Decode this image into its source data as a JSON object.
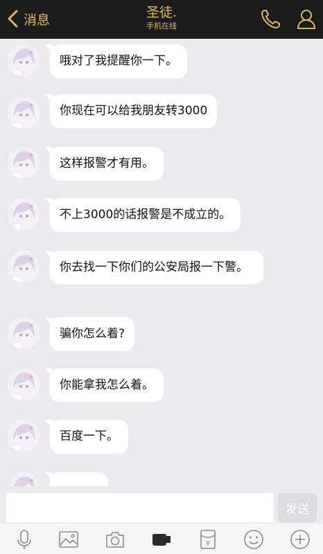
{
  "header": {
    "back_label": "消息",
    "contact_name": "圣徒.",
    "status": "手机在线"
  },
  "messages": [
    {
      "text": "哦对了我提醒你一下。"
    },
    {
      "text": "你现在可以给我朋友转3000"
    },
    {
      "text": "这样报警才有用。"
    },
    {
      "text": "不上3000的话报警是不成立的。"
    },
    {
      "text": "你去找一下你们的公安局报一下警。"
    },
    {
      "text": "骗你怎么着?"
    },
    {
      "text": "你能拿我怎么着。"
    },
    {
      "text": "百度一下。"
    }
  ],
  "composer": {
    "input_value": "",
    "send_label": "发送"
  },
  "toolbar": {
    "icons": [
      "microphone-icon",
      "image-icon",
      "camera-icon",
      "video-icon",
      "red-packet-icon",
      "emoji-icon",
      "plus-icon"
    ],
    "red_packet_symbol": "¥"
  },
  "colors": {
    "header_bg": "#1b1b1b",
    "accent": "#e3b65a",
    "chat_bg": "#ebebef",
    "bubble": "#ffffff"
  }
}
